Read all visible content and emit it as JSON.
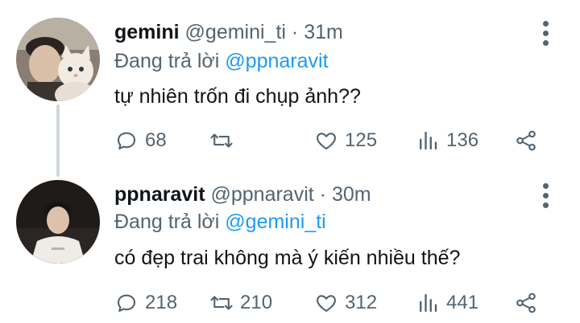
{
  "tweets": [
    {
      "name": "gemini",
      "handle": "@gemini_ti",
      "separator": "·",
      "time": "31m",
      "reply_prefix": "Đang trả lời",
      "reply_to": "@ppnaravit",
      "text": "tự nhiên trốn đi chụp ảnh??",
      "replies": "68",
      "retweets": "",
      "likes": "125",
      "views": "136"
    },
    {
      "name": "ppnaravit",
      "handle": "@ppnaravit",
      "separator": "·",
      "time": "30m",
      "reply_prefix": "Đang trả lời",
      "reply_to": "@gemini_ti",
      "text": "có đẹp trai không mà ý kiến nhiều thế?",
      "replies": "218",
      "retweets": "210",
      "likes": "312",
      "views": "441"
    }
  ],
  "icons": {
    "reply": "speech-bubble-icon",
    "retweet": "retweet-icon",
    "like": "heart-icon",
    "views": "bar-chart-icon",
    "share": "share-icon",
    "more": "more-vertical-icon"
  },
  "colors": {
    "text": "#0f1419",
    "secondary": "#536471",
    "link": "#1d9bf0",
    "thread_line": "#cfd9de"
  }
}
